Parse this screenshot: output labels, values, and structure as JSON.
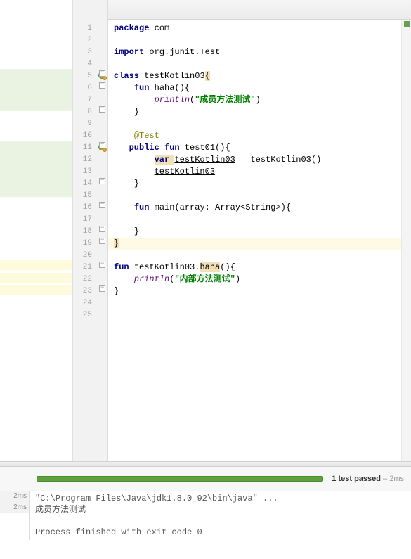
{
  "lines": {
    "l1": "1",
    "l2": "2",
    "l3": "3",
    "l4": "4",
    "l5": "5",
    "l6": "6",
    "l7": "7",
    "l8": "8",
    "l9": "9",
    "l10": "10",
    "l11": "11",
    "l12": "12",
    "l13": "13",
    "l14": "14",
    "l15": "15",
    "l16": "16",
    "l17": "17",
    "l18": "18",
    "l19": "19",
    "l20": "20",
    "l21": "21",
    "l22": "22",
    "l23": "23",
    "l24": "24",
    "l25": "25"
  },
  "code": {
    "pkg_kw": "package",
    "pkg_name": " com",
    "imp_kw": "import",
    "imp_name": " org.junit.Test",
    "class_kw": "class ",
    "class_name": "testKotlin03",
    "ob": "{",
    "fun_kw": "fun ",
    "haha_name": "haha",
    "paren_empty": "()",
    "ob2": "{",
    "println": "println",
    "str_member": "\"成员方法测试\"",
    "cb": "}",
    "test_anno": "@Test",
    "public_kw": "public ",
    "test01_name": "test01",
    "test01_suffix": "(){",
    "var_kw": "var ",
    "var_name": "testKotlin03",
    "eq": " = testKotlin03()",
    "call": "testKotlin03",
    ".haha": ".haha()",
    "main_sig": "main",
    "main_params": "(array: Array<String>){",
    "ext_fun": "testKotlin03.",
    "ext_haha": "haha",
    "ext_suffix": "(){",
    "str_inner": "\"内部方法测试\"",
    "outer_close": "}",
    "rparen": ")",
    "lparen": "("
  },
  "run": {
    "progress_label_strong": "1 test passed",
    "progress_label_dim": " – 2ms",
    "time1": "2ms",
    "time2": "2ms",
    "cmd": "\"C:\\Program Files\\Java\\jdk1.8.0_92\\bin\\java\" ...",
    "out1": "成员方法测试",
    "exit": "Process finished with exit code 0"
  }
}
